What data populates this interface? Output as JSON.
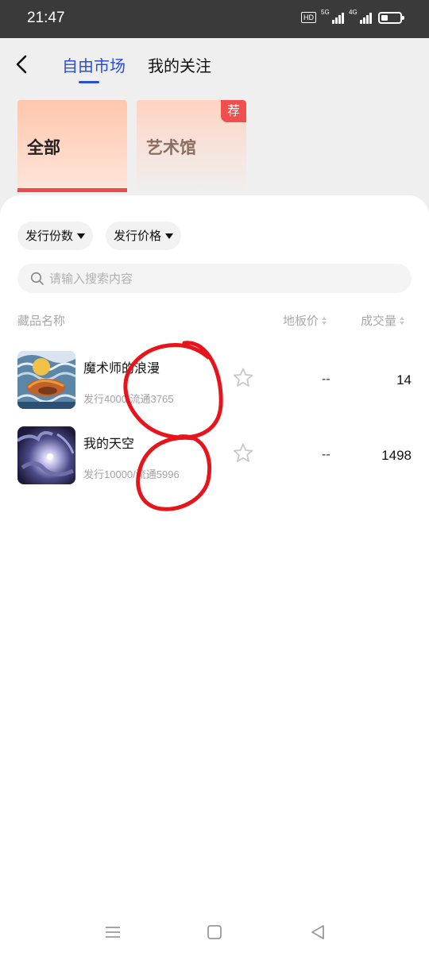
{
  "status": {
    "time": "21:47",
    "hd": "HD",
    "net1": "5G",
    "net2": "4G",
    "battery_level": 0.35
  },
  "header": {
    "tabs": [
      {
        "label": "自由市场",
        "active": true
      },
      {
        "label": "我的关注",
        "active": false
      }
    ]
  },
  "categories": [
    {
      "label": "全部",
      "selected": true
    },
    {
      "label": "艺术馆",
      "badge": "荐"
    }
  ],
  "filters": [
    {
      "label": "发行份数"
    },
    {
      "label": "发行价格"
    }
  ],
  "search": {
    "placeholder": "请输入搜索内容"
  },
  "table": {
    "headers": {
      "name": "藏品名称",
      "floor": "地板价",
      "volume": "成交量"
    },
    "rows": [
      {
        "title": "魔术师的浪漫",
        "sub": "发行4000/流通3765",
        "floor": "--",
        "volume": "14",
        "starred": false
      },
      {
        "title": "我的天空",
        "sub": "发行10000/流通5996",
        "floor": "--",
        "volume": "1498",
        "starred": false
      }
    ]
  },
  "colors": {
    "accent": "#2a4ed8",
    "badge": "#ef4f4f",
    "annotation": "#e8141c"
  }
}
